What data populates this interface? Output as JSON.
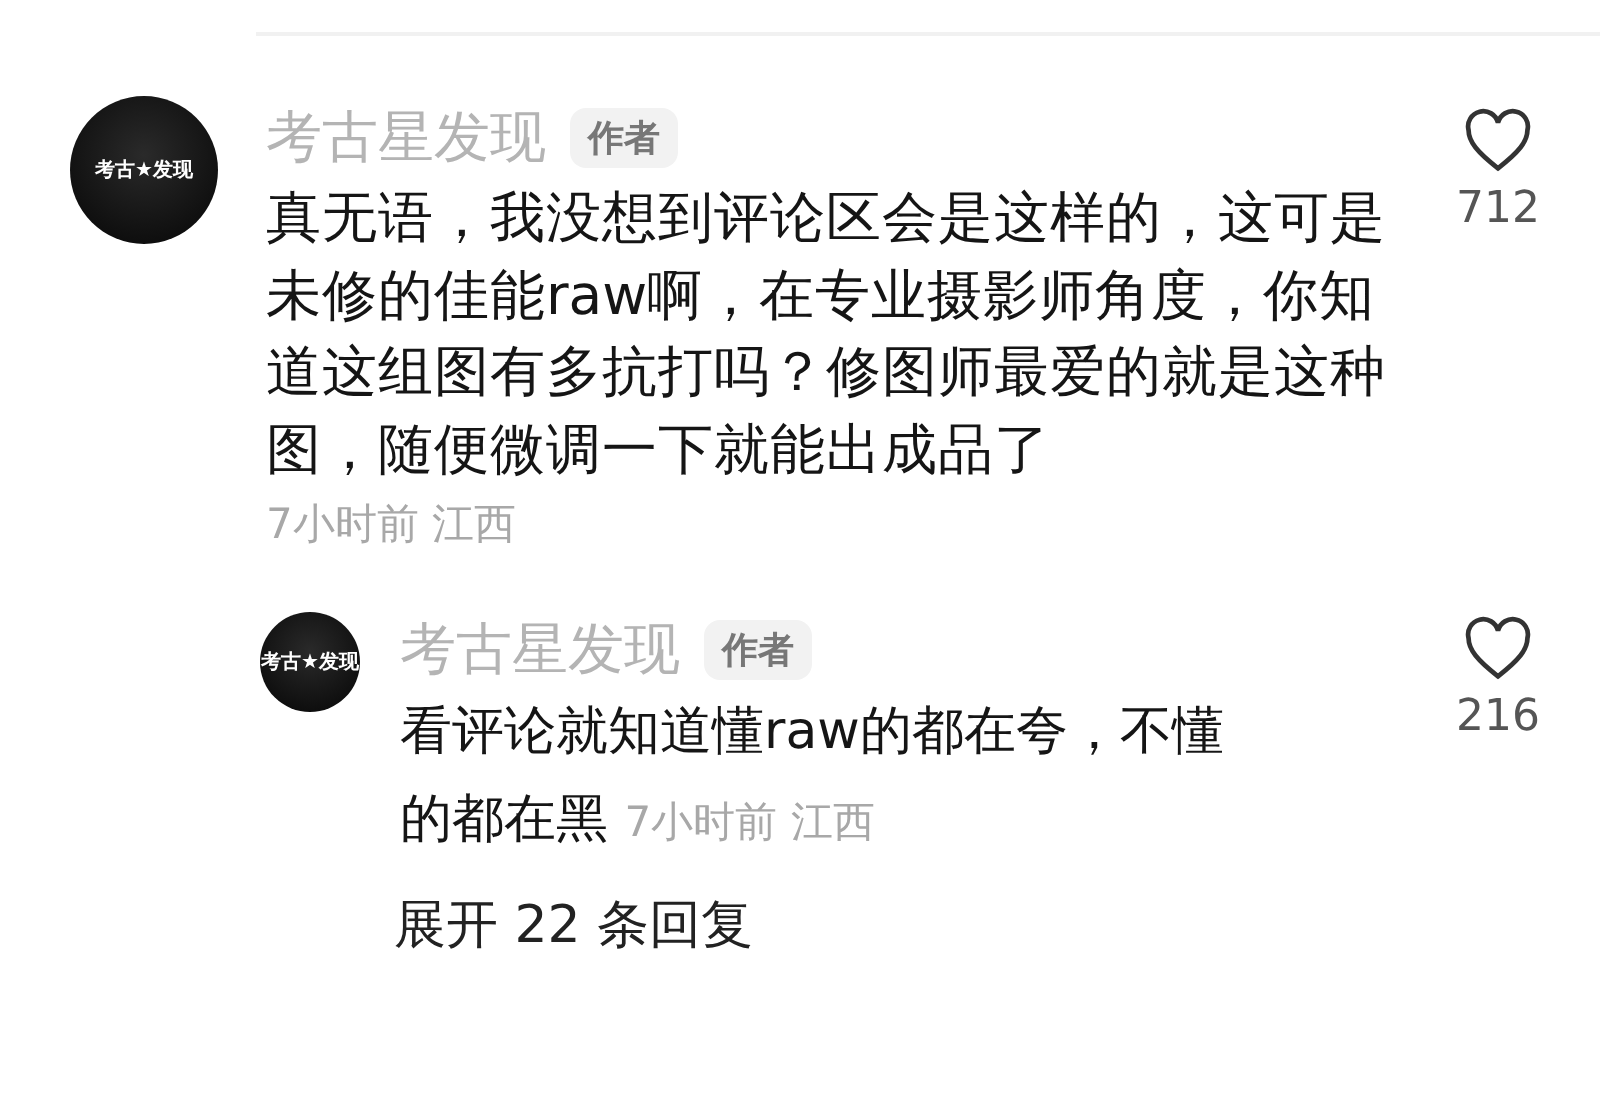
{
  "comment": {
    "avatar_text": "考古★发现",
    "author": "考古星发现",
    "badge": "作者",
    "text": "真无语，我没想到评论区会是这样的，这可是未修的佳能raw啊，在专业摄影师角度，你知道这组图有多抗打吗？修图师最爱的就是这种图，随便微调一下就能出成品了",
    "meta": "7小时前 江西",
    "likes": "712",
    "liked": false
  },
  "reply": {
    "avatar_text": "考古★发现",
    "author": "考古星发现",
    "badge": "作者",
    "lines": [
      "看评论就知道懂raw的都在夸，不懂",
      "的都在黑"
    ],
    "meta": "7小时前 江西",
    "likes": "216",
    "liked": false
  },
  "expand": "展开 22 条回复"
}
